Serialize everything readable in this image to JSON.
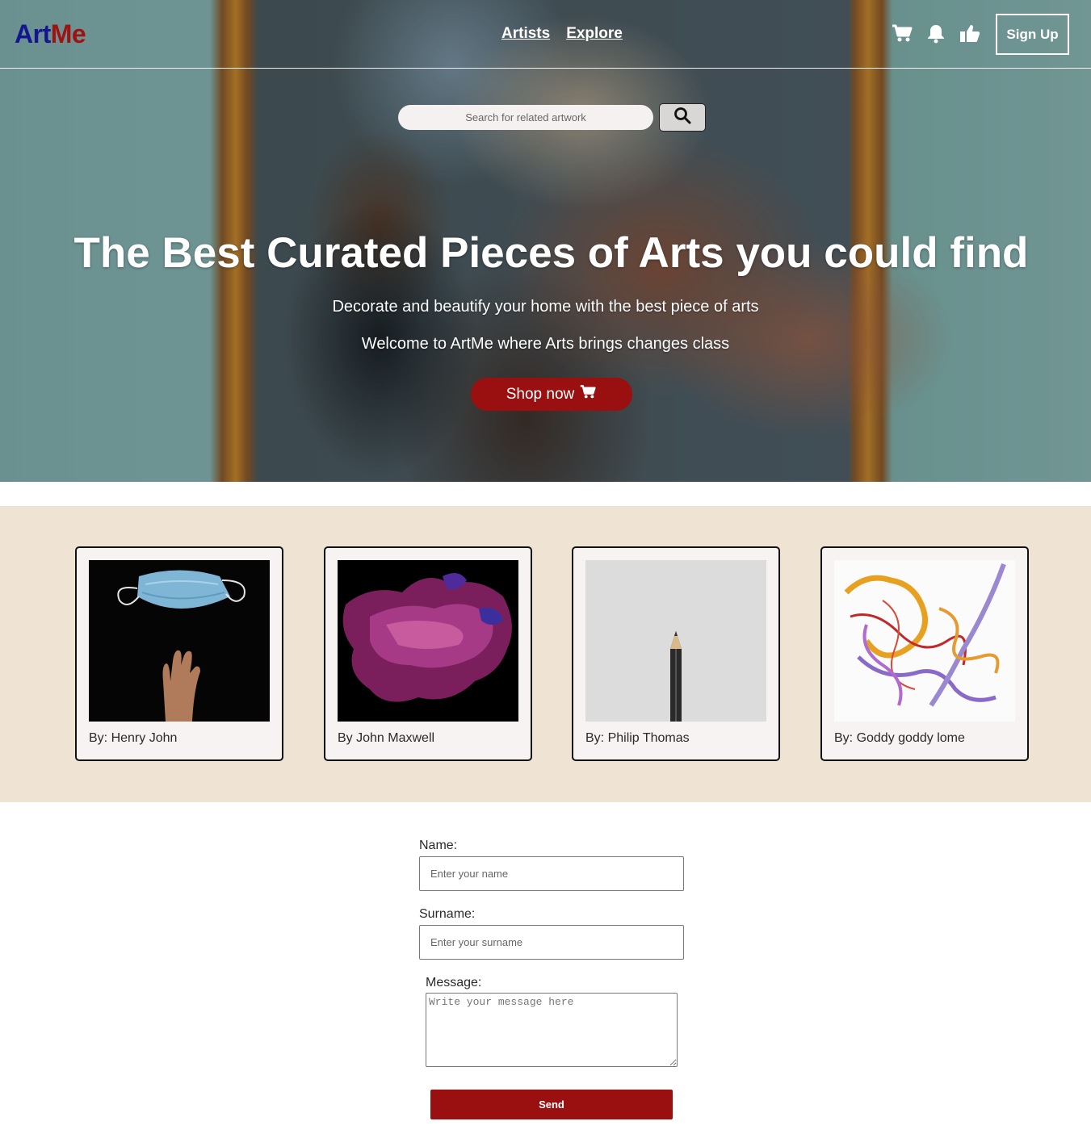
{
  "brand": {
    "part1": "Art",
    "part2": "Me",
    "color1": "#15168f",
    "color2": "#a01212"
  },
  "nav": {
    "links": [
      "Artists",
      "Explore"
    ],
    "icons": [
      "cart-icon",
      "bell-icon",
      "thumbs-up-icon"
    ],
    "signup_label": "Sign Up"
  },
  "search": {
    "placeholder": "Search for related artwork",
    "button_icon": "search-icon"
  },
  "hero": {
    "title": "The Best Curated Pieces of Arts you could find",
    "subtitle1": "Decorate and beautify your home with the best piece of arts",
    "subtitle2": "Welcome to ArtMe where Arts brings changes class",
    "cta_label": "Shop now",
    "cta_icon": "cart-icon",
    "accent": "#9a1010"
  },
  "gallery": {
    "background": "#efe3d4",
    "cards": [
      {
        "caption": "By: Henry John"
      },
      {
        "caption": "By John Maxwell"
      },
      {
        "caption": "By: Philip Thomas"
      },
      {
        "caption": "By: Goddy goddy lome"
      }
    ]
  },
  "form": {
    "name_label": "Name:",
    "name_placeholder": "Enter your name",
    "surname_label": "Surname:",
    "surname_placeholder": "Enter your surname",
    "message_label": "Message:",
    "message_placeholder": "Write your message here",
    "send_label": "Send"
  }
}
